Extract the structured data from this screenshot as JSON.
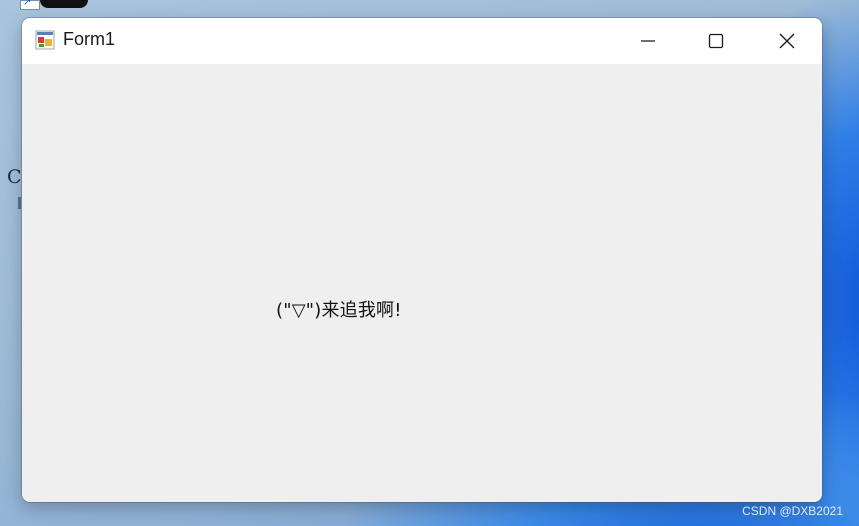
{
  "window": {
    "title": "Form1",
    "controls": {
      "minimize": "minimize",
      "maximize": "maximize",
      "close": "close"
    }
  },
  "form": {
    "label1_text": "(\"▽\")来追我啊!"
  },
  "desktop": {
    "icon_letter": "C",
    "watermark": "CSDN @DXB2021"
  },
  "colors": {
    "titlebar": "#ffffff",
    "client_area": "#efefef",
    "text": "#111111",
    "wallpaper_accent": "#1b63d9"
  },
  "icons": {
    "app_icon": "winforms-app-icon",
    "minimize": "minimize-icon",
    "maximize": "maximize-icon",
    "close": "close-icon"
  }
}
